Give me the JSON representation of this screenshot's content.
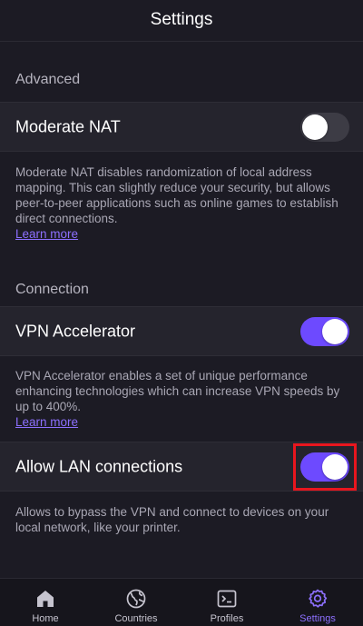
{
  "header": {
    "title": "Settings"
  },
  "sections": {
    "advanced": {
      "label": "Advanced",
      "moderate_nat": {
        "label": "Moderate NAT",
        "enabled": false,
        "description": "Moderate NAT disables randomization of local address mapping. This can slightly reduce your security, but allows peer-to-peer applications such as online games to establish direct connections.",
        "link": "Learn more"
      }
    },
    "connection": {
      "label": "Connection",
      "vpn_accelerator": {
        "label": "VPN Accelerator",
        "enabled": true,
        "description": "VPN Accelerator enables a set of unique performance enhancing technologies which can increase VPN speeds by up to 400%.",
        "link": "Learn more"
      },
      "allow_lan": {
        "label": "Allow LAN connections",
        "enabled": true,
        "description": "Allows to bypass the VPN and connect to devices on your local network, like your printer."
      }
    }
  },
  "tabbar": {
    "tabs": [
      {
        "label": "Home",
        "icon": "home-icon",
        "active": false
      },
      {
        "label": "Countries",
        "icon": "globe-icon",
        "active": false
      },
      {
        "label": "Profiles",
        "icon": "terminal-icon",
        "active": false
      },
      {
        "label": "Settings",
        "icon": "gear-icon",
        "active": true
      }
    ]
  },
  "colors": {
    "background": "#1c1b24",
    "row_background": "#25242d",
    "accent": "#6d4aff",
    "link": "#8d70ff",
    "toggle_off": "#3d3c45",
    "highlight": "#e8161e"
  }
}
